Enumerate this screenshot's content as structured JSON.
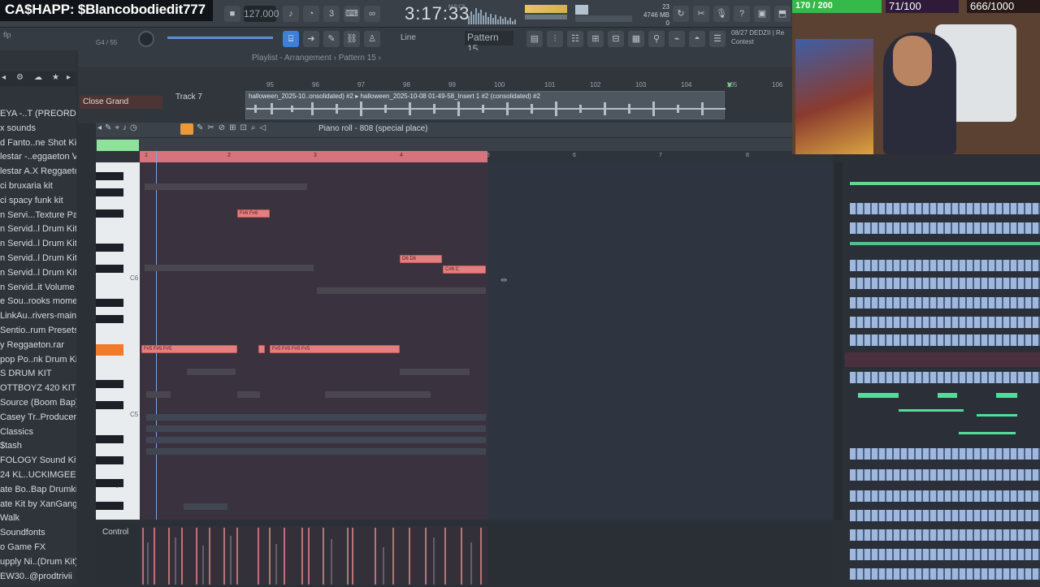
{
  "overlay": {
    "cashapp_text": "CA$HAPP: $Blancobodiedit777"
  },
  "toolbar": {
    "bpm": "127.000",
    "time": "3:17:33",
    "time_unit": "M:S:CS",
    "mem_top": "23",
    "mem_val": "4746 MB",
    "mem_bottom": "0"
  },
  "toolbar2": {
    "snap_label": "Line",
    "pattern_label": "Pattern 15",
    "status_line1": "08/27  DEDZII | Re",
    "status_line2": "Contest"
  },
  "browser": {
    "header_left": "flp",
    "header_right": "G4 / 55",
    "items": [
      "EYA -..T (PREORDER)",
      "x sounds",
      "d Fanto..ne Shot Kit",
      "lestar -..eggaeton V2",
      "lestar A.X Reggaeton",
      "ci bruxaria kit",
      "ci spacy funk kit",
      "n Servi...Texture Pack",
      "n Servid..l Drum Kit 1",
      "n Servid..l Drum Kit 4",
      "n Servid..l Drum Kit 5",
      "n Servid..l Drum Kit 6",
      "n Servid..it Volume 5",
      "e Sou..rooks moment",
      "LinkAu..rivers-main",
      "Sentio..rum Presets",
      "y Reggaeton.rar",
      "pop Po..nk Drum Kit",
      "S DRUM KIT",
      "OTTBOYZ 420 KIT",
      "Source (Boom Bap)",
      "Casey Tr..Producer Kit",
      "Classics",
      "$tash",
      "FOLOGY Sound Kit",
      "24 KL..UCKIMGEEKED",
      "ate Bo..Bap Drumkit",
      "ate Kit by XanGang",
      "Walk",
      "Soundfonts",
      "o Game FX",
      "upply Ni..(Drum Kit)",
      "EW30..@prodtrivii"
    ]
  },
  "playlist": {
    "title": "Playlist - Arrangement › Pattern 15 ›",
    "ruler": [
      "95",
      "96",
      "97",
      "98",
      "99",
      "100",
      "101",
      "102",
      "103",
      "104",
      "105",
      "106"
    ],
    "track_label": "Close Grand",
    "track_name": "Track 7",
    "clip_label": "halloween_2025-10..onsolidated) #2  ▸ halloween_2025-10-08 01-49-58_Insert 1 #2 (consolidated) #2"
  },
  "piano_roll": {
    "title": "Piano roll - 808 (special place)",
    "ruler": [
      "1",
      "2",
      "3",
      "4",
      "5",
      "6",
      "7",
      "8"
    ],
    "key_labels": [
      "C6",
      "C5"
    ],
    "notes": [
      {
        "label": "F#6 F#6"
      },
      {
        "label": "D6   D6"
      },
      {
        "label": "C#6  C"
      },
      {
        "label": "F#5  F#5  F#5"
      },
      {
        "label": "F#5 F#5 F#5 F#5"
      }
    ],
    "control_label": "Control"
  },
  "webcam": {
    "kick_stat": "170 / 200",
    "sub_stat": "71/100",
    "yt_stat": "666/1000"
  },
  "colors": {
    "accent": "#8ee29b",
    "note": "#e37f7f",
    "key_active": "#f07a2c"
  }
}
